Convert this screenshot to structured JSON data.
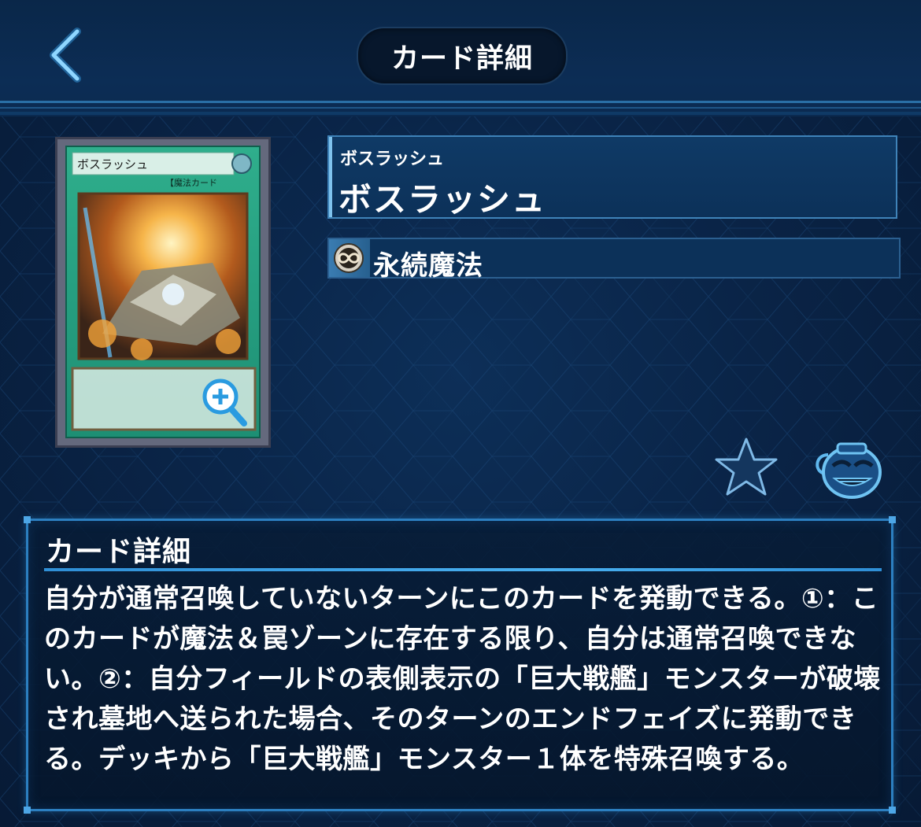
{
  "header": {
    "title": "カード詳細"
  },
  "card": {
    "name_ruby": "ボスラッシュ",
    "name": "ボスラッシュ",
    "art_name": "ボスラッシュ",
    "art_type_line": "【魔法カード",
    "type_label": "永続魔法",
    "type_icon": "continuous-spell-icon"
  },
  "detail": {
    "heading": "カード詳細",
    "text": "自分が通常召喚していないターンにこのカードを発動できる。①：このカードが魔法＆罠ゾーンに存在する限り、自分は通常召喚できない。②：自分フィールドの表側表示の「巨大戦艦」モンスターが破壊され墓地へ送られた場合、そのターンのエンドフェイズに発動できる。デッキから「巨大戦艦」モンスター１体を特殊召喚する。"
  },
  "icons": {
    "back": "chevron-left-icon",
    "zoom": "magnifier-plus-icon",
    "favorite": "star-icon",
    "pot": "pot-of-greed-icon"
  },
  "colors": {
    "background": "#0a2447",
    "accent": "#2c7fc0",
    "spell_card": "#1e9a7d"
  }
}
